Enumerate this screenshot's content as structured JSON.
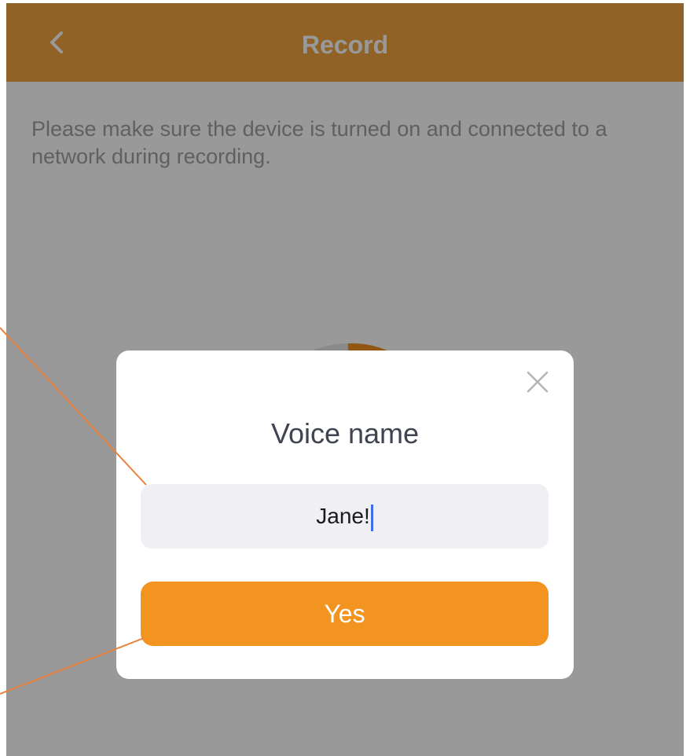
{
  "header": {
    "title": "Record",
    "back_icon": "chevron-left-icon"
  },
  "instructions": "Please make sure the device is turned on and connected to a network during recording.",
  "dialog": {
    "title": "Voice name",
    "input_value": "Jane!",
    "confirm_label": "Yes",
    "close_icon": "close-icon"
  },
  "colors": {
    "navbar": "#f1a340",
    "accent_button": "#f39320",
    "overlay": "rgba(0,0,0,0.40)",
    "input_bg": "#efeff4",
    "annotation_line": "#e8803a"
  }
}
